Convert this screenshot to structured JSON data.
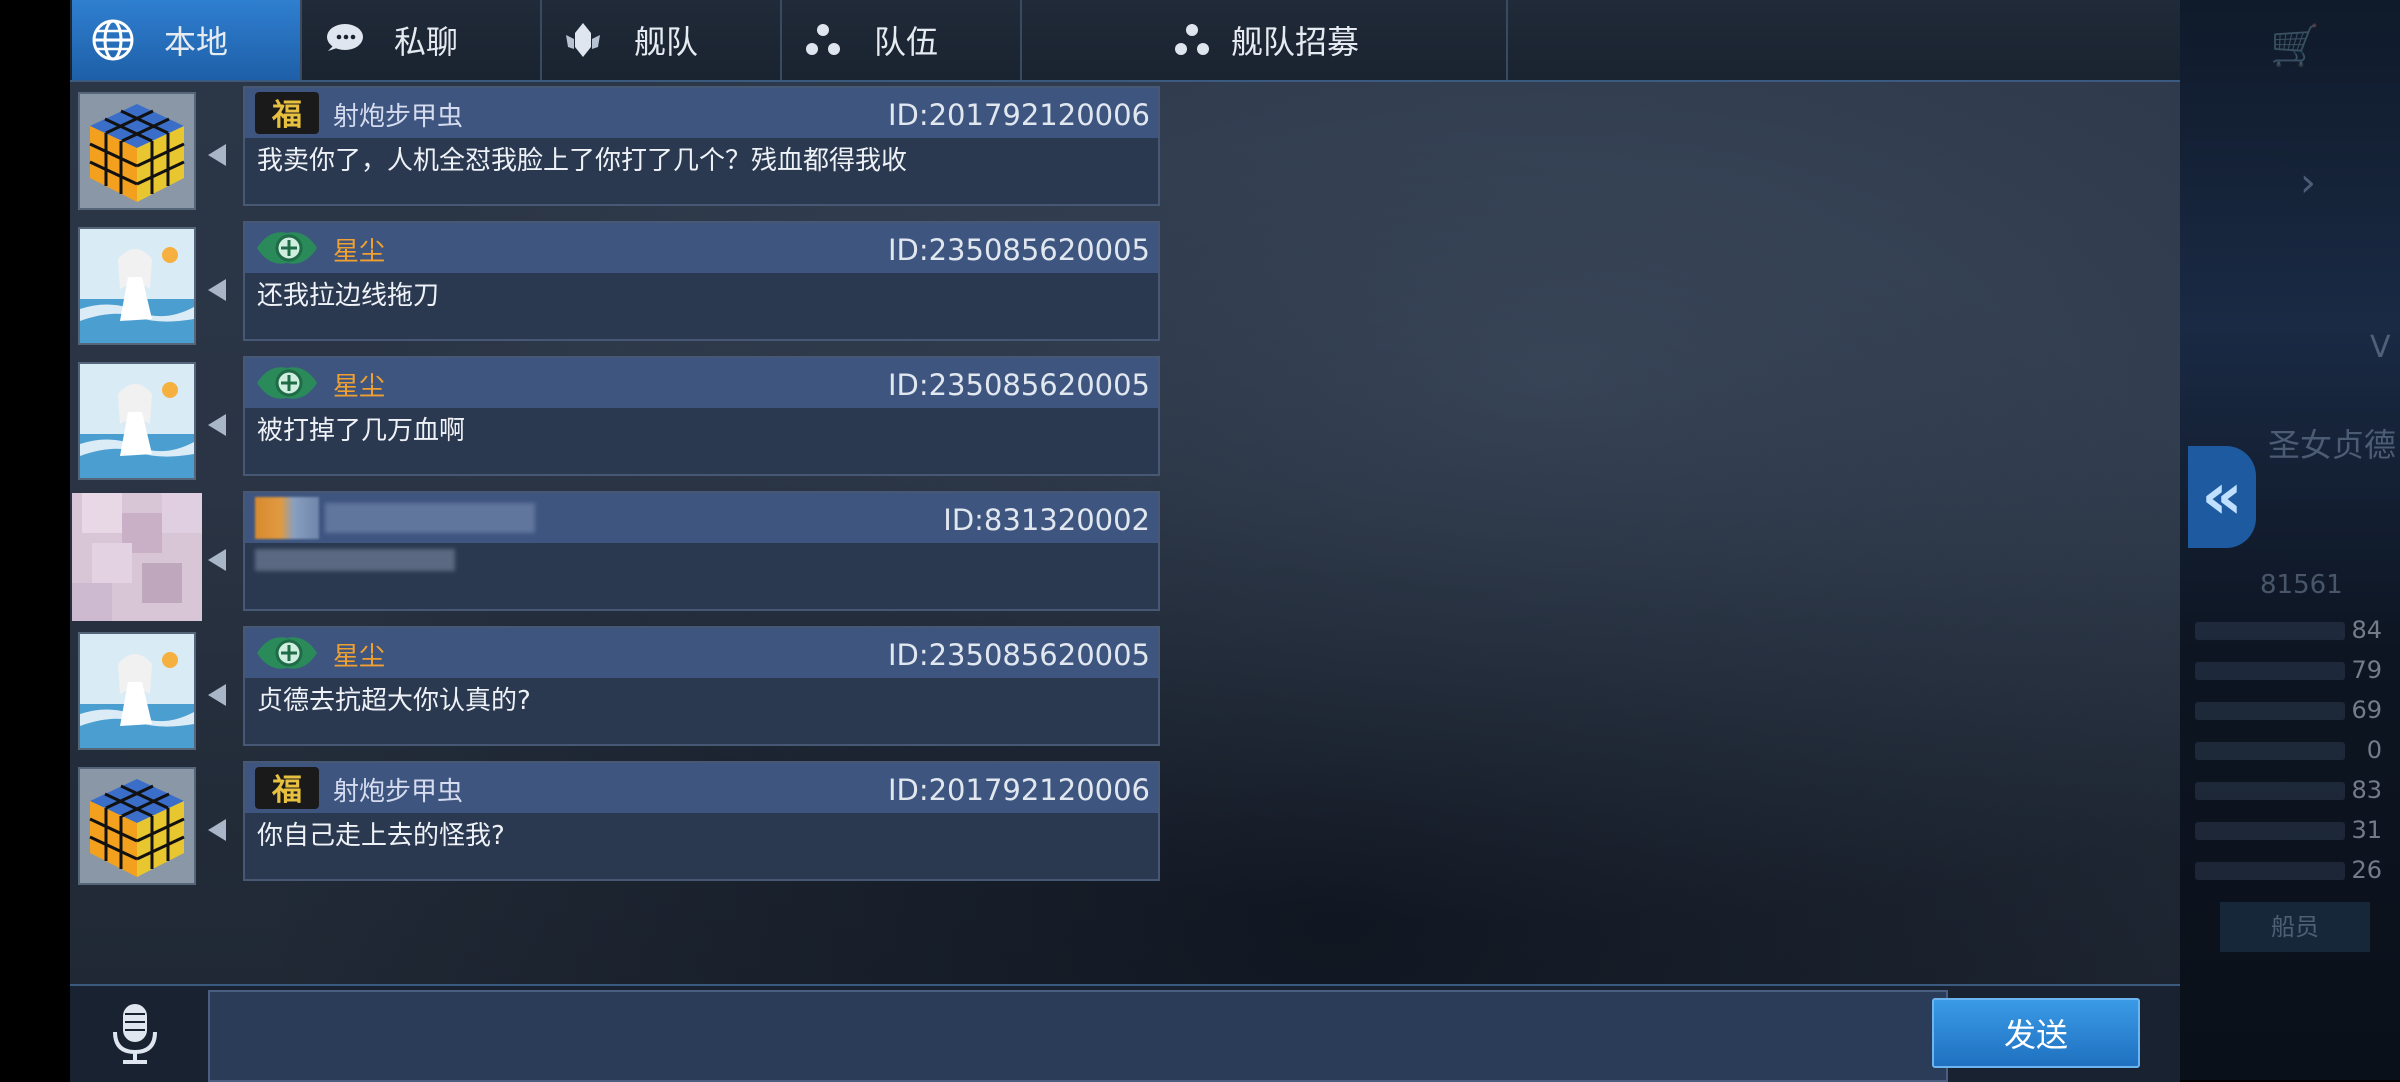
{
  "tabs": [
    {
      "label": "本地",
      "icon": "globe-icon",
      "active": true
    },
    {
      "label": "私聊",
      "icon": "chat-bubble-icon",
      "active": false
    },
    {
      "label": "舰队",
      "icon": "fleet-emblem-icon",
      "active": false
    },
    {
      "label": "队伍",
      "icon": "team-dots-icon",
      "active": false
    },
    {
      "label": "舰队招募",
      "icon": "recruit-dots-icon",
      "active": false
    }
  ],
  "messages": [
    {
      "name": "射炮步甲虫",
      "id": "ID:201792120006",
      "text": "我卖你了，人机全怼我脸上了你打了几个？残血都得我收",
      "avatar": "rubik-cube-avatar",
      "badge": "fu-badge",
      "name_color": "#d6dcef"
    },
    {
      "name": "星尘",
      "id": "ID:235085620005",
      "text": "还我拉边线拖刀",
      "avatar": "anime-girl-avatar",
      "badge": "green-emblem-badge",
      "name_color": "#f0a030"
    },
    {
      "name": "星尘",
      "id": "ID:235085620005",
      "text": "被打掉了几万血啊",
      "avatar": "anime-girl-avatar",
      "badge": "green-emblem-badge",
      "name_color": "#f0a030"
    },
    {
      "name": "",
      "id": "ID:831320002",
      "text": "",
      "avatar": "blurred-avatar",
      "badge": "blurred-badge",
      "name_color": "#d6dcef"
    },
    {
      "name": "星尘",
      "id": "ID:235085620005",
      "text": "贞德去抗超大你认真的?",
      "avatar": "anime-girl-avatar",
      "badge": "green-emblem-badge",
      "name_color": "#f0a030"
    },
    {
      "name": "射炮步甲虫",
      "id": "ID:201792120006",
      "text": "你自己走上去的怪我?",
      "avatar": "rubik-cube-avatar",
      "badge": "fu-badge",
      "name_color": "#d6dcef"
    }
  ],
  "input": {
    "value": "",
    "placeholder": ""
  },
  "send_label": "发送",
  "colors": {
    "accent": "#2f7fd0",
    "header": "#3e5580",
    "bubble": "#2a3850",
    "orange_name": "#f0a030"
  },
  "background_game": {
    "text1": "圣女贞德",
    "text2": "81561",
    "stats": [
      "84",
      "79",
      "69",
      "0",
      "83",
      "31",
      "26"
    ],
    "crew_label": "船员",
    "v_label": "V"
  }
}
